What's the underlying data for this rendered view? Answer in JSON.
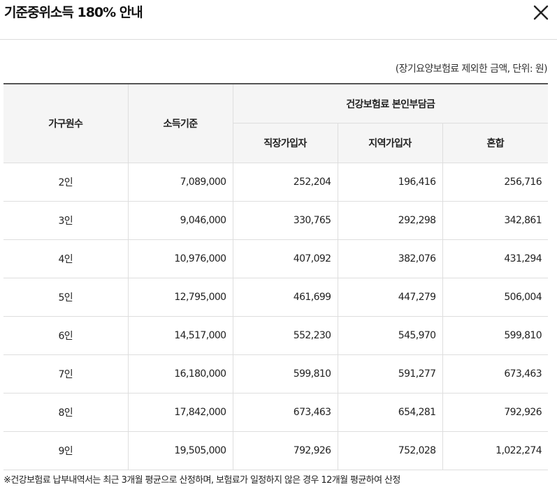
{
  "modal": {
    "title": "기준중위소득 180% 안내",
    "close_icon": "close-icon"
  },
  "unit_note": "(장기요양보험료 제외한 금액, 단위: 원)",
  "table": {
    "headers": {
      "household": "가구원수",
      "income_standard": "소득기준",
      "premium_group": "건강보험료 본인부담금",
      "employee": "직장가입자",
      "regional": "지역가입자",
      "mixed": "혼합"
    },
    "rows": [
      {
        "household": "2인",
        "income_standard": "7,089,000",
        "employee": "252,204",
        "regional": "196,416",
        "mixed": "256,716"
      },
      {
        "household": "3인",
        "income_standard": "9,046,000",
        "employee": "330,765",
        "regional": "292,298",
        "mixed": "342,861"
      },
      {
        "household": "4인",
        "income_standard": "10,976,000",
        "employee": "407,092",
        "regional": "382,076",
        "mixed": "431,294"
      },
      {
        "household": "5인",
        "income_standard": "12,795,000",
        "employee": "461,699",
        "regional": "447,279",
        "mixed": "506,004"
      },
      {
        "household": "6인",
        "income_standard": "14,517,000",
        "employee": "552,230",
        "regional": "545,970",
        "mixed": "599,810"
      },
      {
        "household": "7인",
        "income_standard": "16,180,000",
        "employee": "599,810",
        "regional": "591,277",
        "mixed": "673,463"
      },
      {
        "household": "8인",
        "income_standard": "17,842,000",
        "employee": "673,463",
        "regional": "654,281",
        "mixed": "792,926"
      },
      {
        "household": "9인",
        "income_standard": "19,505,000",
        "employee": "792,926",
        "regional": "752,028",
        "mixed": "1,022,274"
      }
    ]
  },
  "footnote": "※건강보험료 납부내역서는 최근 3개월 평균으로 산정하며, 보험료가 일정하지 않은 경우 12개월 평균하여 산정"
}
